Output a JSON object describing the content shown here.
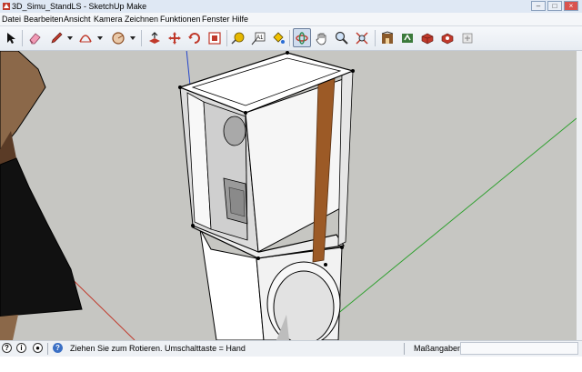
{
  "window": {
    "title": "3D_Simu_StandLS - SketchUp Make"
  },
  "menu": [
    {
      "id": "datei",
      "label": "Datei"
    },
    {
      "id": "bearbeiten",
      "label": "Bearbeiten"
    },
    {
      "id": "ansicht",
      "label": "Ansicht"
    },
    {
      "id": "kamera",
      "label": "Kamera"
    },
    {
      "id": "zeichnen",
      "label": "Zeichnen"
    },
    {
      "id": "funktionen",
      "label": "Funktionen"
    },
    {
      "id": "fenster",
      "label": "Fenster"
    },
    {
      "id": "hilfe",
      "label": "Hilfe"
    }
  ],
  "toolbar": {
    "tools": [
      {
        "id": "select",
        "icon": "select-arrow-icon"
      },
      {
        "id": "eraser",
        "icon": "eraser-icon"
      },
      {
        "id": "pencil",
        "icon": "pencil-icon",
        "dropdown": true
      },
      {
        "id": "arc",
        "icon": "arc-icon",
        "dropdown": true
      },
      {
        "id": "circle",
        "icon": "circle-icon",
        "dropdown": true
      },
      {
        "id": "push-pull",
        "icon": "push-pull-icon"
      },
      {
        "id": "move",
        "icon": "move-icon"
      },
      {
        "id": "rotate",
        "icon": "rotate-icon"
      },
      {
        "id": "scale",
        "icon": "scale-icon"
      },
      {
        "id": "tape",
        "icon": "tape-measure-icon"
      },
      {
        "id": "text",
        "icon": "text-icon"
      },
      {
        "id": "paint",
        "icon": "paint-bucket-icon"
      },
      {
        "id": "orbit",
        "icon": "orbit-icon",
        "active": true
      },
      {
        "id": "pan",
        "icon": "pan-hand-icon"
      },
      {
        "id": "zoom",
        "icon": "zoom-icon"
      },
      {
        "id": "zoom-extents",
        "icon": "zoom-extents-icon"
      },
      {
        "id": "warehouse",
        "icon": "3d-warehouse-icon"
      },
      {
        "id": "share",
        "icon": "share-model-icon"
      },
      {
        "id": "components",
        "icon": "get-components-icon"
      },
      {
        "id": "extensions",
        "icon": "extension-warehouse-icon"
      }
    ]
  },
  "status": {
    "hint": "Ziehen Sie zum Rotieren.  Umschalttaste = Hand",
    "measurements_label": "Maßangaben",
    "measurements_value": ""
  },
  "colors": {
    "viewport_bg": "#c6c6c2",
    "panel_face": "#f4f4f4",
    "brace_wood": "#9c5a26",
    "axis_green": "#2fa02f",
    "axis_red": "#c0392b",
    "axis_blue": "#2244cc"
  }
}
